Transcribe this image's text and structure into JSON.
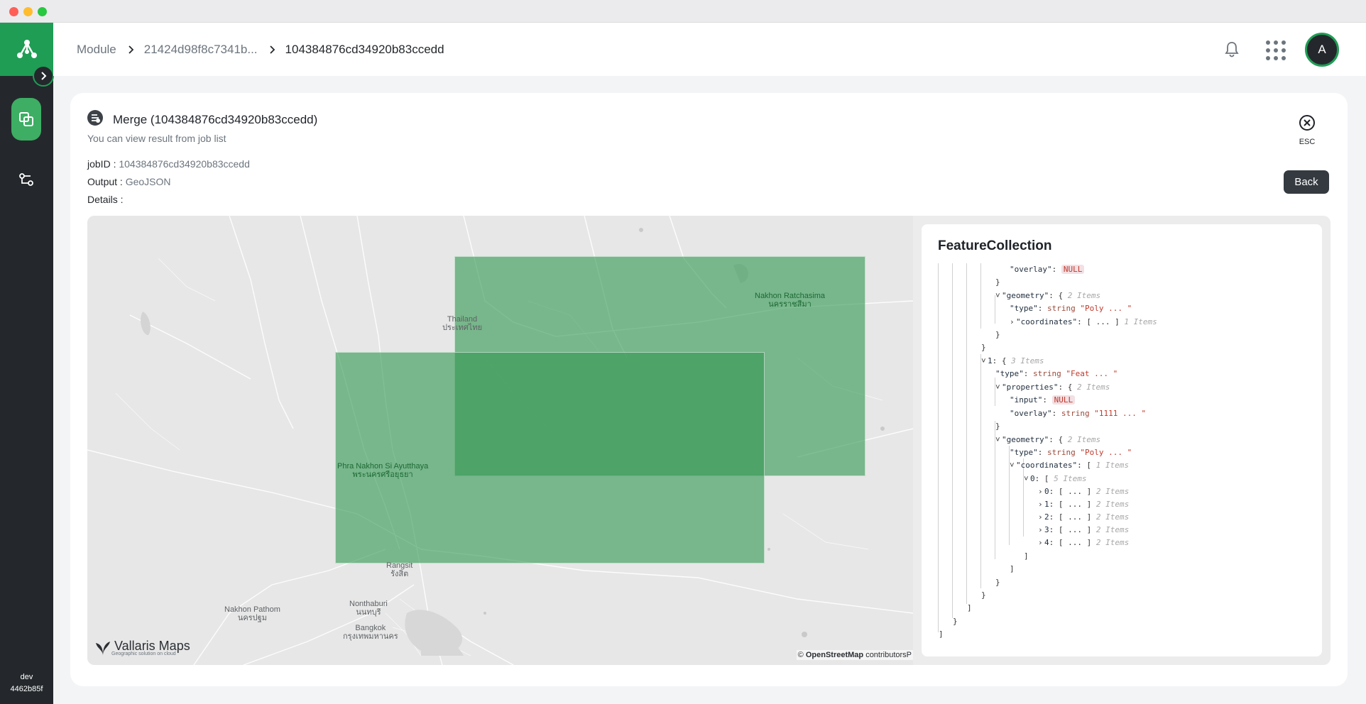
{
  "window": {
    "controls": [
      "close",
      "minimize",
      "zoom"
    ]
  },
  "sidebar": {
    "logo_icon": "vallaris-logo-icon",
    "toggle_icon": "chevron-right-icon",
    "nav": [
      {
        "name": "data-layers",
        "icon": "layers-icon",
        "active": true
      },
      {
        "name": "process-flow",
        "icon": "workflow-icon",
        "active": false
      }
    ],
    "footer": {
      "env": "dev",
      "build": "4462b85f"
    }
  },
  "header": {
    "breadcrumbs": [
      "Module",
      "21424d98f8c7341b...",
      "104384876cd34920b83ccedd"
    ],
    "bell_icon": "bell-icon",
    "apps_icon": "apps-grid-icon",
    "avatar_letter": "A"
  },
  "card": {
    "title": "Merge (104384876cd34920b83ccedd)",
    "subtitle": "You can view result from job list",
    "job_id_label": "jobID :",
    "job_id": "104384876cd34920b83ccedd",
    "output_label": "Output :",
    "output": "GeoJSON",
    "details_label": "Details :",
    "esc_label": "ESC",
    "back_label": "Back"
  },
  "map": {
    "places": {
      "thailand": "Thailand",
      "thailand_th": "ประเทศไทย",
      "ratchasima": "Nakhon Ratchasima",
      "ratchasima_th": "นครราชสีมา",
      "ayutthaya": "Phra Nakhon Si Ayutthaya",
      "ayutthaya_th": "พระนครศรีอยุธยา",
      "rangsit": "Rangsit",
      "rangsit_th": "รังสิต",
      "nonthaburi": "Nonthaburi",
      "nonthaburi_th": "นนทบุรี",
      "pathom": "Nakhon Pathom",
      "pathom_th": "นครปฐม",
      "bangkok": "Bangkok",
      "bangkok_th": "กรุงเทพมหานคร"
    },
    "logo_text": "Vallaris Maps",
    "logo_tagline": "Geographic solution on cloud",
    "attribution_prefix": "©",
    "attribution_osm": "OpenStreetMap",
    "attribution_suffix": "contributorsP",
    "fill_color": "#349752"
  },
  "json_view": {
    "title": "FeatureCollection",
    "lines": {
      "l1_key": "\"overlay\"",
      "l1_val": "NULL",
      "l3_key": "\"geometry\"",
      "l3_count": "2 Items",
      "l4_key": "\"type\"",
      "l4_type": "string",
      "l4_val": "\"Poly ... \"",
      "l5_key": "\"coordinates\"",
      "l5_val": "[ ... ]",
      "l5_count": "1 Items",
      "l8_key": "1",
      "l8_count": "3 Items",
      "l9_key": "\"type\"",
      "l9_type": "string",
      "l9_val": "\"Feat ... \"",
      "l10_key": "\"properties\"",
      "l10_count": "2 Items",
      "l11_key": "\"input\"",
      "l11_val": "NULL",
      "l12_key": "\"overlay\"",
      "l12_type": "string",
      "l12_val": "\"1111 ... \"",
      "l14_key": "\"geometry\"",
      "l14_count": "2 Items",
      "l15_key": "\"type\"",
      "l15_type": "string",
      "l15_val": "\"Poly ... \"",
      "l16_key": "\"coordinates\"",
      "l16_count": "1 Items",
      "l17_key": "0",
      "l17_count": "5 Items",
      "coords": [
        {
          "key": "0",
          "val": "[ ... ]",
          "count": "2 Items"
        },
        {
          "key": "1",
          "val": "[ ... ]",
          "count": "2 Items"
        },
        {
          "key": "2",
          "val": "[ ... ]",
          "count": "2 Items"
        },
        {
          "key": "3",
          "val": "[ ... ]",
          "count": "2 Items"
        },
        {
          "key": "4",
          "val": "[ ... ]",
          "count": "2 Items"
        }
      ]
    }
  },
  "colors": {
    "brand_green": "#1f9d55",
    "sidebar_dark": "#24282c",
    "back_button": "#343a40"
  }
}
